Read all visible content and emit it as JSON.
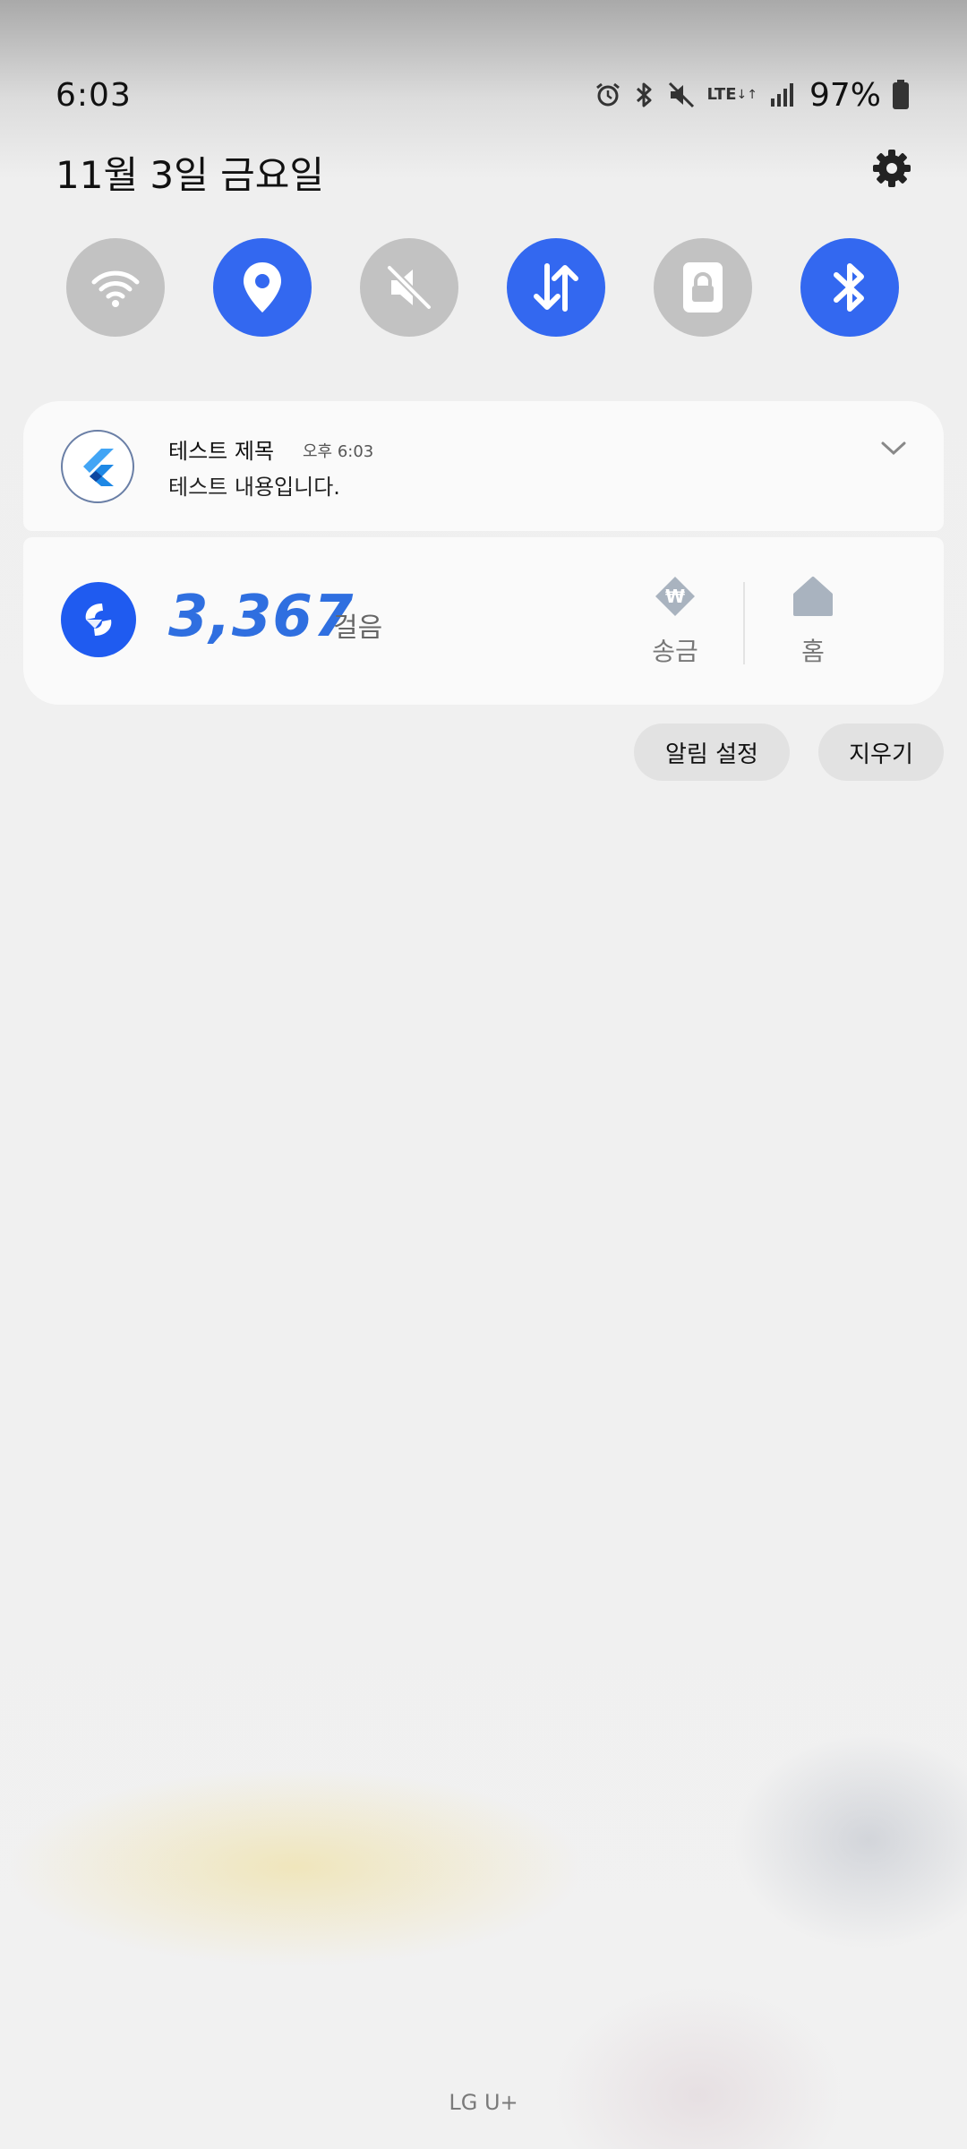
{
  "status_bar": {
    "time": "6:03",
    "network_type": "LTE",
    "battery_percent": "97%",
    "icons": [
      "alarm-icon",
      "bluetooth-icon",
      "mute-icon",
      "lte-data-icon",
      "signal-icon",
      "battery-icon"
    ]
  },
  "header": {
    "date": "11월 3일 금요일",
    "settings_icon": "gear-icon"
  },
  "quick_settings": [
    {
      "icon": "wifi-icon",
      "state": "off"
    },
    {
      "icon": "location-icon",
      "state": "on"
    },
    {
      "icon": "sound-mute-icon",
      "state": "off"
    },
    {
      "icon": "mobile-data-icon",
      "state": "on"
    },
    {
      "icon": "lock-icon",
      "state": "off"
    },
    {
      "icon": "bluetooth-icon",
      "state": "on"
    }
  ],
  "notification": {
    "app_icon": "flutter-logo-icon",
    "title": "테스트 제목",
    "time": "오후 6:03",
    "body": "테스트 내용입니다."
  },
  "steps_widget": {
    "app_icon": "toss-logo-icon",
    "count": "3,367",
    "unit": "걸음",
    "actions": [
      {
        "label": "송금",
        "icon": "won-transfer-icon"
      },
      {
        "label": "홈",
        "icon": "home-icon"
      }
    ]
  },
  "buttons": {
    "notification_settings": "알림 설정",
    "clear": "지우기"
  },
  "carrier": "LG U+",
  "colors": {
    "tile_on": "#3368f0",
    "tile_off": "#c2c2c2",
    "step_count": "#2f6fe0"
  }
}
